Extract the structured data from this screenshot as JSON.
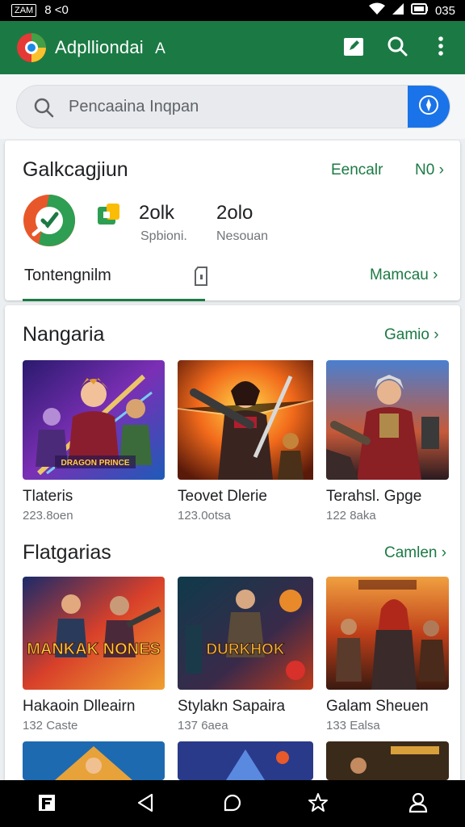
{
  "status_bar": {
    "chip": "ZAM",
    "time_left": "8 <0",
    "time_right": "035"
  },
  "app_bar": {
    "title": "Adplliondai",
    "title_suffix": "A"
  },
  "search": {
    "placeholder": "Pencaaina Inqpan"
  },
  "summary_card": {
    "title": "Galkcagjiun",
    "link_primary": "Eencalr",
    "link_secondary": "N0",
    "stats": [
      {
        "value": "2olk",
        "label": "Spbioni."
      },
      {
        "value": "2olo",
        "label": "Nesouan"
      }
    ],
    "tab_label": "Tontengnilm",
    "tab_link": "Mamcau"
  },
  "sections": [
    {
      "title": "Nangaria",
      "more": "Gamio",
      "items": [
        {
          "name": "Tlateris",
          "sub": "223.8oen",
          "cover_text": "DRAGON PRINCE"
        },
        {
          "name": "Teovet Dlerie",
          "sub": "123.0otsa",
          "cover_text": ""
        },
        {
          "name": "Terahsl. Gpge",
          "sub": "122 8aka",
          "cover_text": ""
        }
      ]
    },
    {
      "title": "Flatgarias",
      "more": "Camlen",
      "items": [
        {
          "name": "Hakaoin Dlleairn",
          "sub": "132 Caste",
          "cover_text": "MANKAK NONES"
        },
        {
          "name": "Stylakn Sapaira",
          "sub": "137 6aea",
          "cover_text": "DURKHOK"
        },
        {
          "name": "Galam Sheuen",
          "sub": "133 Ealsa",
          "cover_text": ""
        }
      ]
    }
  ],
  "colors": {
    "brand_green": "#1b7a44",
    "accent_blue": "#1a73e8"
  }
}
